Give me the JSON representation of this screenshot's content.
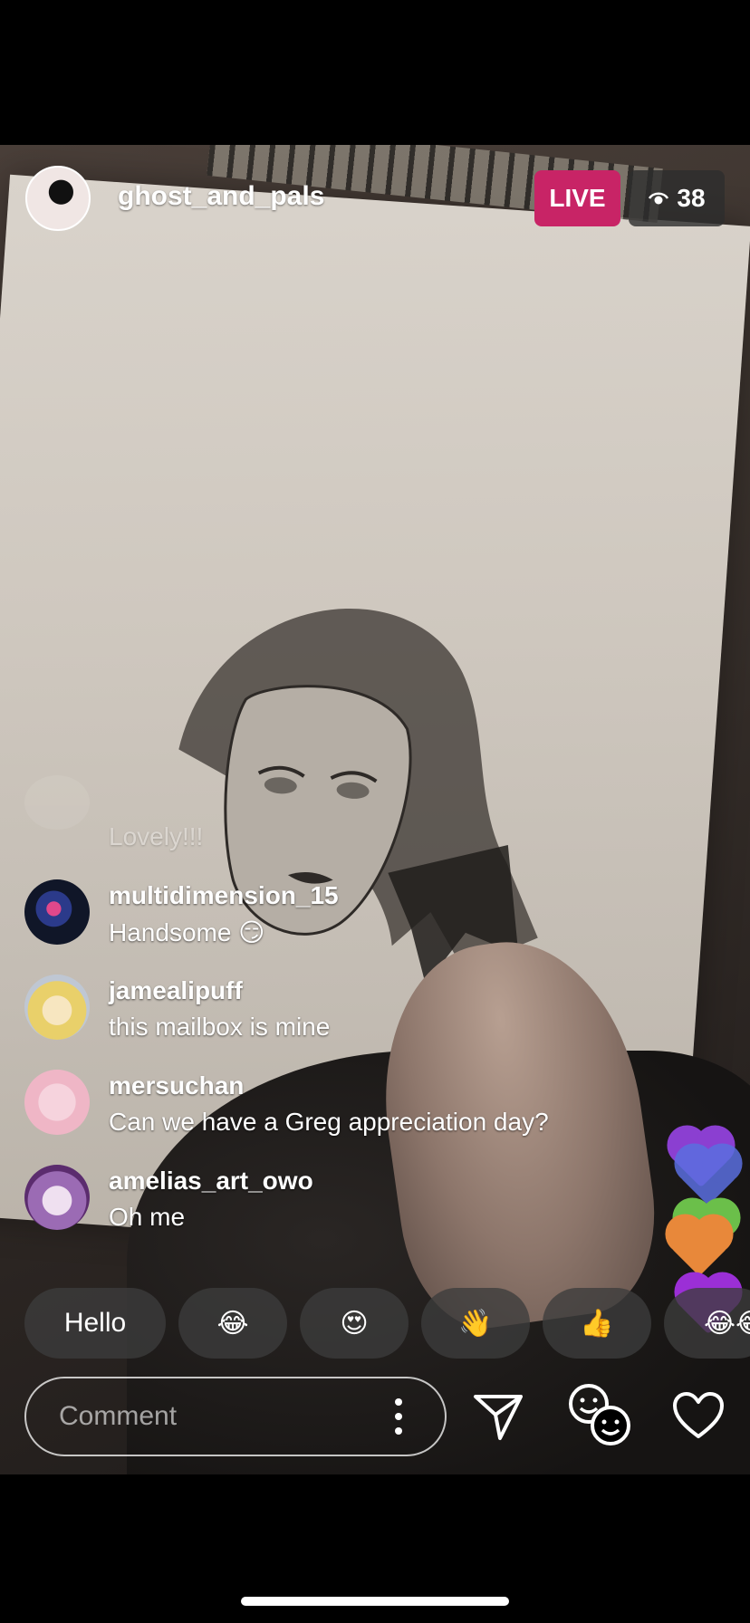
{
  "stream": {
    "host_username": "ghost_and_pals",
    "live_label": "LIVE",
    "viewer_count": "38"
  },
  "colors": {
    "live_badge": "#c82466",
    "viewer_badge": "#2d2d2d",
    "text": "#ffffff"
  },
  "comments": [
    {
      "username": "",
      "text": "Lovely!!!",
      "faded": true
    },
    {
      "username": "multidimension_15",
      "text": "Handsome 😏"
    },
    {
      "username": "jamealipuff",
      "text": "this mailbox is mine"
    },
    {
      "username": "mersuchan",
      "text": "Can we have a Greg appreciation day?"
    },
    {
      "username": "amelias_art_owo",
      "text": "Oh me"
    }
  ],
  "quick_reactions": [
    "Hello",
    "😂",
    "😍",
    "👋",
    "👍",
    "😂😂"
  ],
  "comment_bar": {
    "placeholder": "Comment"
  },
  "icons": {
    "viewers": "eye-icon",
    "more": "more-vertical-icon",
    "send": "send-icon",
    "emoji": "emoji-faces-icon",
    "like": "heart-icon"
  }
}
